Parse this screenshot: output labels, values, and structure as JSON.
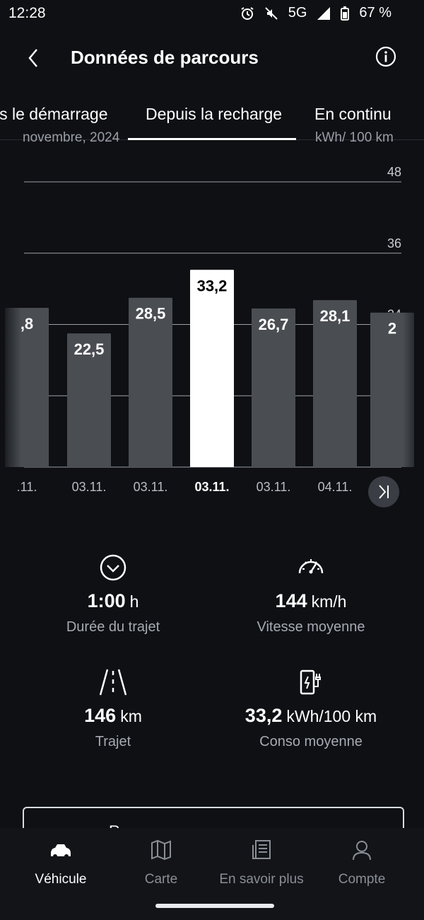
{
  "status": {
    "time": "12:28",
    "network": "5G",
    "battery": "67 %"
  },
  "header": {
    "title": "Données de parcours",
    "back_icon": "chevron-left-icon",
    "info_icon": "info-icon"
  },
  "tabs": {
    "items": [
      "is le démarrage",
      "Depuis la recharge",
      "En continu"
    ],
    "active": "Depuis la recharge"
  },
  "chart_top": {
    "left_cut": "novembre, 2024",
    "right_cut": "kWh/ 100 km"
  },
  "chart_data": {
    "type": "bar",
    "categories": [
      ".11.",
      "03.11.",
      "03.11.",
      "03.11.",
      "03.11.",
      "04.11.",
      ""
    ],
    "values": [
      26.8,
      22.5,
      28.5,
      33.2,
      26.7,
      28.1,
      26.0
    ],
    "labels": [
      ",8",
      "22,5",
      "28,5",
      "33,2",
      "26,7",
      "28,1",
      "2"
    ],
    "selected_index": 3,
    "yticks": [
      "0",
      "12",
      "24",
      "36",
      "48"
    ],
    "ylim": [
      0,
      48
    ],
    "grid": true
  },
  "chart_controls": {
    "jump_end_icon": "skip-to-end-icon"
  },
  "stats": [
    {
      "icon": "clock-chevron-icon",
      "value": "1:00",
      "unit": "h",
      "label": "Durée du trajet"
    },
    {
      "icon": "speedometer-icon",
      "value": "144",
      "unit": "km/h",
      "label": "Vitesse moyenne"
    },
    {
      "icon": "road-icon",
      "value": "146",
      "unit": "km",
      "label": "Trajet"
    },
    {
      "icon": "charging-station-icon",
      "value": "33,2",
      "unit": "kWh/100 km",
      "label": "Conso moyenne"
    }
  ],
  "partial_button": {
    "text": "R..."
  },
  "nav": [
    {
      "label": "Véhicule",
      "icon": "car-icon",
      "active": true
    },
    {
      "label": "Carte",
      "icon": "map-icon",
      "active": false
    },
    {
      "label": "En savoir plus",
      "icon": "news-icon",
      "active": false
    },
    {
      "label": "Compte",
      "icon": "user-icon",
      "active": false
    }
  ],
  "colors": {
    "background": "#0e1014",
    "bar": "#4a4d52",
    "bar_selected": "#ffffff",
    "grid": "#bfc3c9"
  }
}
